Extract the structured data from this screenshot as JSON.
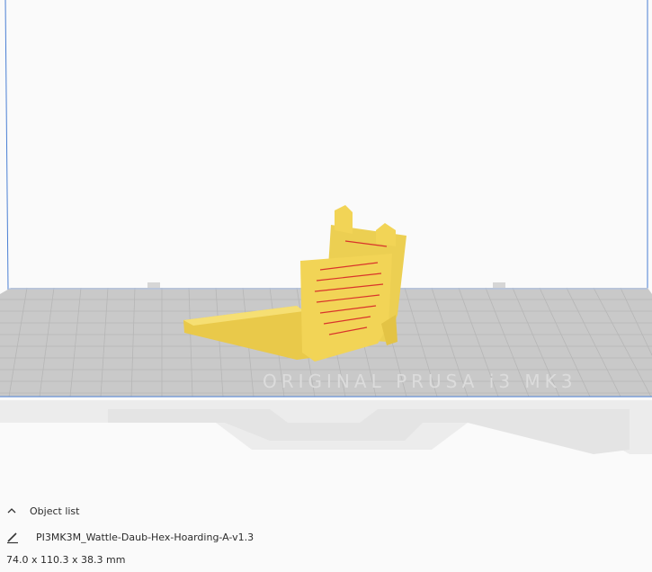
{
  "object_panel": {
    "toggle_label": "Object list",
    "object_name": "PI3MK3M_Wattle-Daub-Hex-Hoarding-A-v1.3",
    "dimensions": "74.0 x 110.3 x 38.3 mm"
  },
  "icons": {
    "toggle": "chevron-up-icon",
    "edit": "pencil-icon"
  },
  "colors": {
    "build_volume_line": "#4a7fd4",
    "plate": "#c9c9c9",
    "model": "#f2d456",
    "model_overhang": "#d9342b",
    "background": "#fafafa"
  },
  "plate_text": "ORIGINAL PRUSA i3 MK3"
}
